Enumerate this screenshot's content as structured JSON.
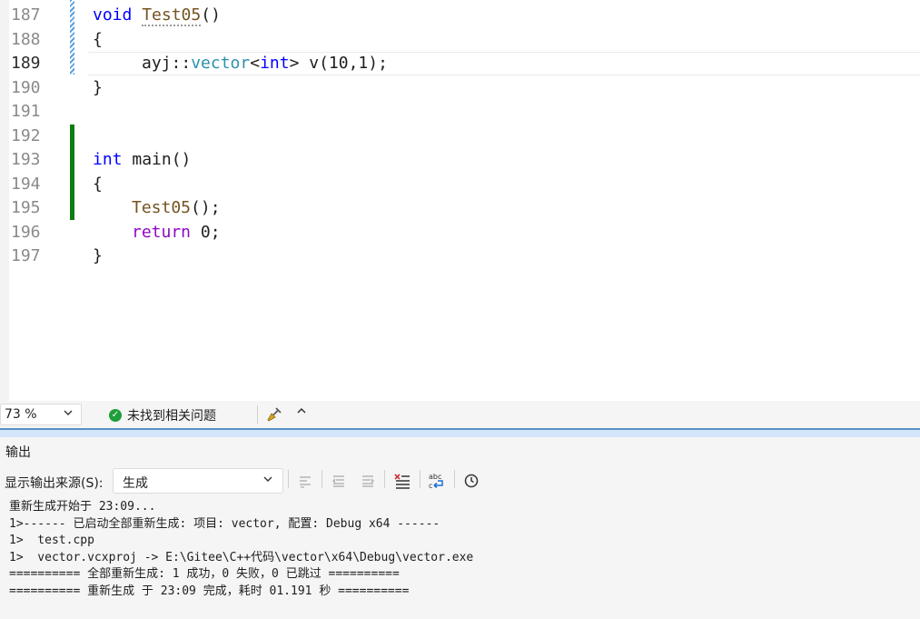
{
  "editor": {
    "lines": [
      {
        "num": "187"
      },
      {
        "num": "188"
      },
      {
        "num": "189"
      },
      {
        "num": "190"
      },
      {
        "num": "191"
      },
      {
        "num": "192"
      },
      {
        "num": "193"
      },
      {
        "num": "194"
      },
      {
        "num": "195"
      },
      {
        "num": "196"
      },
      {
        "num": "197"
      }
    ],
    "tokens": {
      "l187_kw": "void",
      "l187_fn": "Test05",
      "l187_rest": "()",
      "l188": "{",
      "l189_ns": "ayj::",
      "l189_ty": "vector",
      "l189_lt": "<",
      "l189_kw": "int",
      "l189_rest": "> v(10,1);",
      "l190": "}",
      "l193_kw": "int",
      "l193_rest": " main()",
      "l194": "{",
      "l195_fn": "Test05",
      "l195_rest": "();",
      "l196_kw": "return",
      "l196_rest": " 0;",
      "l197": "}"
    }
  },
  "statusbar": {
    "zoom": "73 %",
    "issues_text": "未找到相关问题"
  },
  "output_panel": {
    "title": "输出",
    "source_label": "显示输出来源(S):",
    "source_value": "生成",
    "lines": [
      "重新生成开始于 23:09...",
      "1>------ 已启动全部重新生成: 项目: vector, 配置: Debug x64 ------",
      "1>  test.cpp",
      "1>  vector.vcxproj -> E:\\Gitee\\C++代码\\vector\\x64\\Debug\\vector.exe",
      "========== 全部重新生成: 1 成功，0 失败，0 已跳过 ==========",
      "========== 重新生成 于 23:09 完成，耗时 01.191 秒 =========="
    ]
  },
  "colors": {
    "keyword": "#0000ff",
    "control_keyword": "#8f08c4",
    "function": "#74531f",
    "type": "#2b91af",
    "saved_change_bar": "#107c10",
    "unsaved_change_bar": "#5aa0e0"
  }
}
